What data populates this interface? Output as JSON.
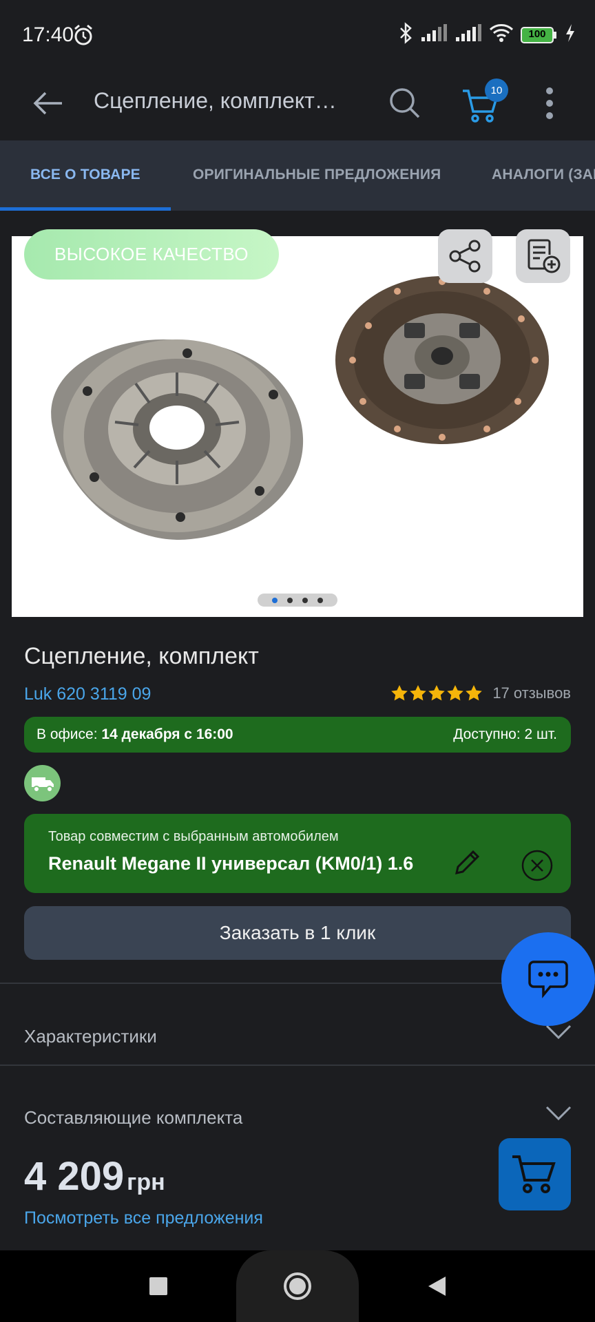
{
  "status_bar": {
    "time": "17:40",
    "battery": "100"
  },
  "app_bar": {
    "title": "Сцепление, комплект…",
    "cart_count": "10"
  },
  "tabs": [
    {
      "label": "ВСЕ О ТОВАРЕ",
      "active": true
    },
    {
      "label": "ОРИГИНАЛЬНЫЕ ПРЕДЛОЖЕНИЯ",
      "active": false
    },
    {
      "label": "АНАЛОГИ (ЗАМ",
      "active": false
    }
  ],
  "gallery": {
    "badge": "ВЫСОКОЕ КАЧЕСТВО",
    "image_count": 4,
    "current_image": 1
  },
  "product": {
    "title": "Сцепление, комплект",
    "article": "Luk 620 3119 09",
    "rating": 5,
    "reviews": "17 отзывов"
  },
  "availability": {
    "office_label": "В офисе:",
    "office_date": "14 декабря с 16:00",
    "available": "Доступно: 2 шт."
  },
  "compatibility": {
    "note": "Товар совместим с выбранным автомобилем",
    "car": "Renault Megane II универсал (KM0/1) 1.6"
  },
  "actions": {
    "quick_order": "Заказать в 1 клик"
  },
  "accordion": [
    {
      "label": "Характеристики"
    },
    {
      "label": "Составляющие комплекта"
    }
  ],
  "price": {
    "value": "4 209",
    "currency": "грн",
    "all_offers": "Посмотреть все предложения"
  },
  "colors": {
    "accent": "#1d6ed6",
    "link": "#4aa6ea",
    "success": "#1e6b1e",
    "star": "#f5b50a"
  }
}
